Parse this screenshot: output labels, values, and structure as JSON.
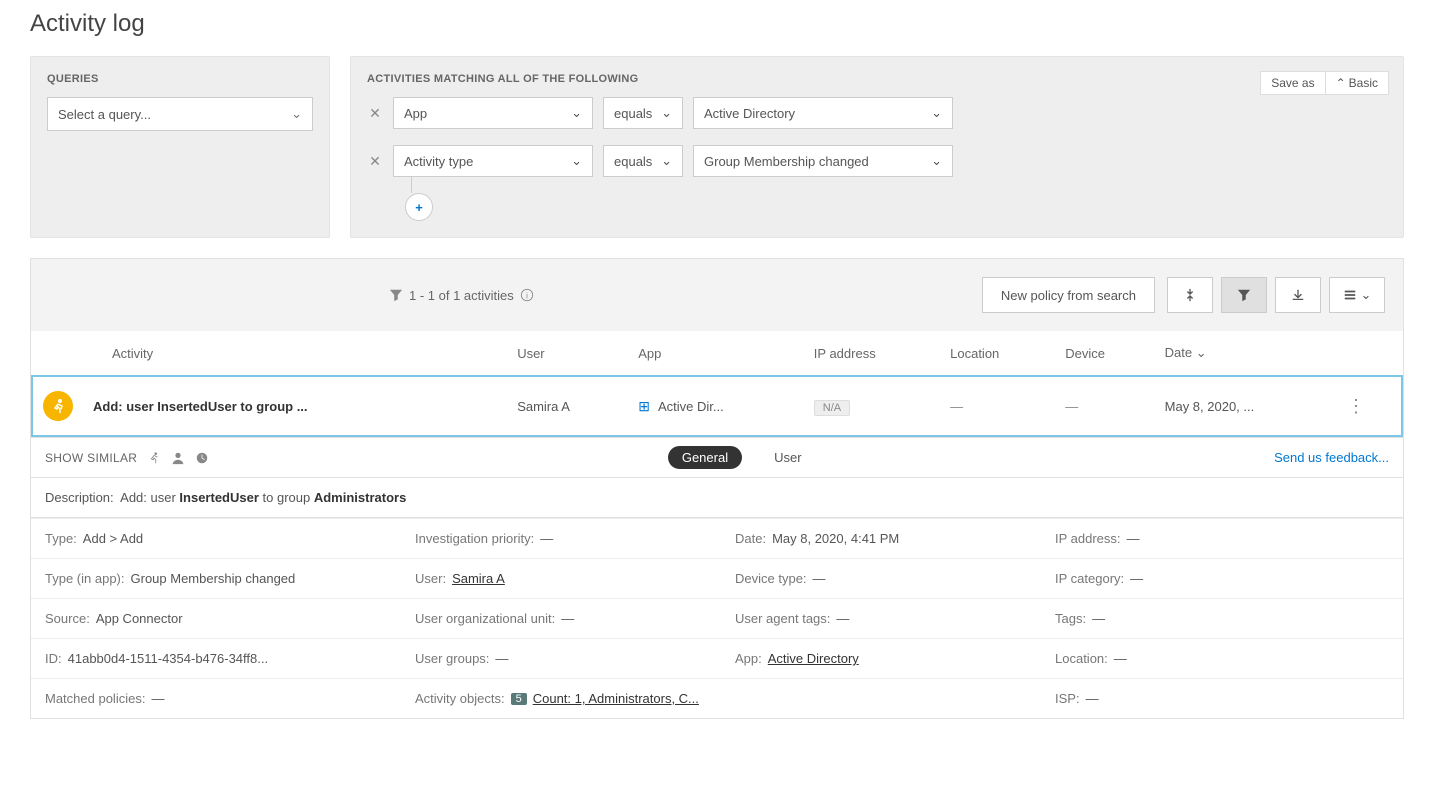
{
  "page": {
    "title": "Activity log"
  },
  "queries": {
    "heading": "QUERIES",
    "select_placeholder": "Select a query..."
  },
  "filters": {
    "heading": "ACTIVITIES MATCHING ALL OF THE FOLLOWING",
    "save_as": "Save as",
    "basic": "Basic",
    "rows": [
      {
        "field": "App",
        "op": "equals",
        "value": "Active Directory"
      },
      {
        "field": "Activity type",
        "op": "equals",
        "value": "Group Membership changed"
      }
    ]
  },
  "results": {
    "count_text": "1 - 1 of 1 activities",
    "new_policy": "New policy from search",
    "columns": {
      "activity": "Activity",
      "user": "User",
      "app": "App",
      "ip": "IP address",
      "location": "Location",
      "device": "Device",
      "date": "Date"
    },
    "row": {
      "activity": "Add: user InsertedUser to group ...",
      "user": "Samira A",
      "app": "Active Dir...",
      "ip": "N/A",
      "location": "—",
      "device": "—",
      "date": "May 8, 2020, ..."
    }
  },
  "details": {
    "show_similar": "SHOW SIMILAR",
    "tabs": {
      "general": "General",
      "user": "User"
    },
    "feedback": "Send us feedback...",
    "description_label": "Description:",
    "description_prefix": "Add: user ",
    "description_user": "InsertedUser",
    "description_mid": " to group ",
    "description_group": "Administrators",
    "fields": {
      "type_k": "Type:",
      "type_v": "Add > Add",
      "investigation_priority_k": "Investigation priority:",
      "investigation_priority_v": "—",
      "date_k": "Date:",
      "date_v": "May 8, 2020, 4:41 PM",
      "ip_address_k": "IP address:",
      "ip_address_v": "—",
      "type_in_app_k": "Type (in app):",
      "type_in_app_v": "Group Membership changed",
      "user_k": "User:",
      "user_v": "Samira A",
      "device_type_k": "Device type:",
      "device_type_v": "—",
      "ip_category_k": "IP category:",
      "ip_category_v": "—",
      "source_k": "Source:",
      "source_v": "App Connector",
      "user_ou_k": "User organizational unit:",
      "user_ou_v": "—",
      "user_agent_tags_k": "User agent tags:",
      "user_agent_tags_v": "—",
      "tags_k": "Tags:",
      "tags_v": "—",
      "id_k": "ID:",
      "id_v": "41abb0d4-1511-4354-b476-34ff8...",
      "user_groups_k": "User groups:",
      "user_groups_v": "—",
      "app_k": "App:",
      "app_v": "Active Directory",
      "location_k": "Location:",
      "location_v": "—",
      "matched_policies_k": "Matched policies:",
      "matched_policies_v": "—",
      "activity_objects_k": "Activity objects:",
      "activity_objects_badge": "5",
      "activity_objects_v": "Count: 1, Administrators, C...",
      "isp_k": "ISP:",
      "isp_v": "—"
    }
  }
}
